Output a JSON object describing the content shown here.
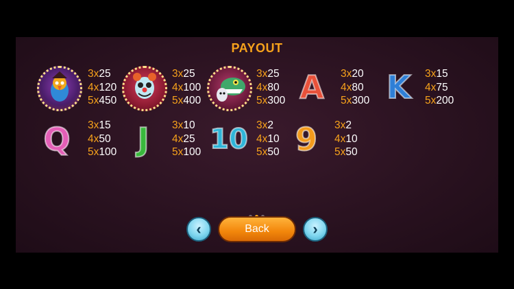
{
  "title": "PAYOUT",
  "symbols": [
    {
      "icon": "parrot-pirate-icon",
      "pays": [
        {
          "n": "3x",
          "v": "25"
        },
        {
          "n": "4x",
          "v": "120"
        },
        {
          "n": "5x",
          "v": "450"
        }
      ]
    },
    {
      "icon": "clown-icon",
      "pays": [
        {
          "n": "3x",
          "v": "25"
        },
        {
          "n": "4x",
          "v": "100"
        },
        {
          "n": "5x",
          "v": "400"
        }
      ]
    },
    {
      "icon": "monster-icon",
      "pays": [
        {
          "n": "3x",
          "v": "25"
        },
        {
          "n": "4x",
          "v": "80"
        },
        {
          "n": "5x",
          "v": "300"
        }
      ]
    },
    {
      "icon": "letter-a-icon",
      "glyph": "A",
      "color": "#e8513a",
      "pays": [
        {
          "n": "3x",
          "v": "20"
        },
        {
          "n": "4x",
          "v": "80"
        },
        {
          "n": "5x",
          "v": "300"
        }
      ]
    },
    {
      "icon": "letter-k-icon",
      "glyph": "K",
      "color": "#2f7fd6",
      "pays": [
        {
          "n": "3x",
          "v": "15"
        },
        {
          "n": "4x",
          "v": "75"
        },
        {
          "n": "5x",
          "v": "200"
        }
      ]
    },
    {
      "icon": "letter-q-icon",
      "glyph": "Q",
      "color": "#e35fb6",
      "pays": [
        {
          "n": "3x",
          "v": "15"
        },
        {
          "n": "4x",
          "v": "50"
        },
        {
          "n": "5x",
          "v": "100"
        }
      ]
    },
    {
      "icon": "letter-j-icon",
      "glyph": "J",
      "color": "#39b83c",
      "pays": [
        {
          "n": "3x",
          "v": "10"
        },
        {
          "n": "4x",
          "v": "25"
        },
        {
          "n": "5x",
          "v": "100"
        }
      ]
    },
    {
      "icon": "number-10-icon",
      "glyph": "10",
      "color": "#2fb5d8",
      "pays": [
        {
          "n": "3x",
          "v": "2"
        },
        {
          "n": "4x",
          "v": "10"
        },
        {
          "n": "5x",
          "v": "50"
        }
      ]
    },
    {
      "icon": "number-9-icon",
      "glyph": "9",
      "color": "#f29a1c",
      "pays": [
        {
          "n": "3x",
          "v": "2"
        },
        {
          "n": "4x",
          "v": "10"
        },
        {
          "n": "5x",
          "v": "50"
        }
      ]
    }
  ],
  "pagination": {
    "pages": 3,
    "current": 2
  },
  "back_label": "Back",
  "prev_glyph": "‹",
  "next_glyph": "›"
}
